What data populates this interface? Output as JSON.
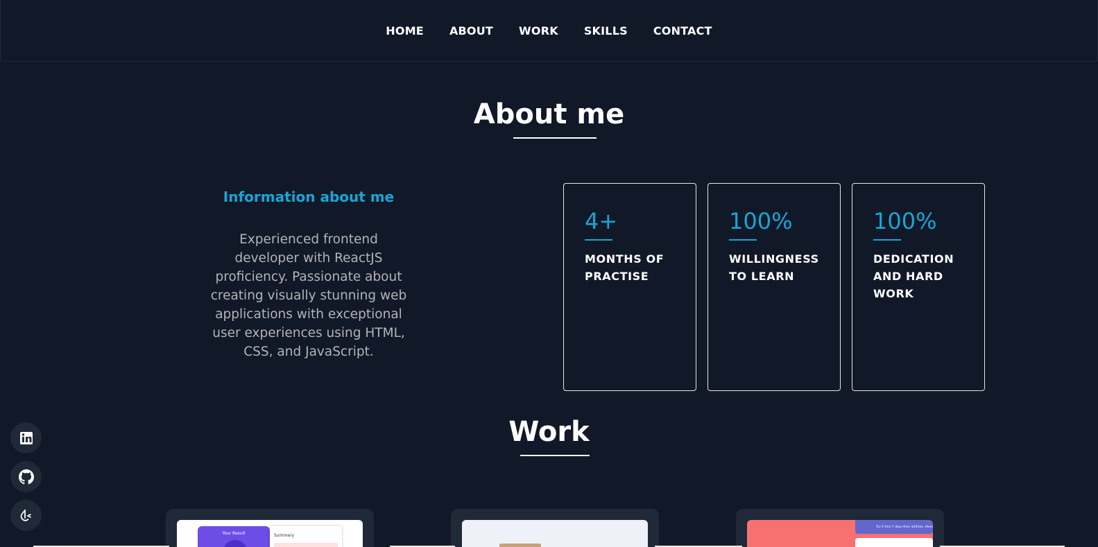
{
  "nav": {
    "items": [
      {
        "label": "HOME"
      },
      {
        "label": "ABOUT"
      },
      {
        "label": "WORK"
      },
      {
        "label": "SKILLS"
      },
      {
        "label": "CONTACT"
      }
    ]
  },
  "about": {
    "title": "About me",
    "info_heading": "Information about me",
    "info_text": "Experienced frontend developer with ReactJS proficiency. Passionate about creating visually stunning web applications with exceptional user experiences using HTML, CSS, and JavaScript.",
    "stats": [
      {
        "value": "4+",
        "label": "MONTHS OF PRACTISE"
      },
      {
        "value": "100%",
        "label": "WILLINGNESS TO LEARN"
      },
      {
        "value": "100%",
        "label": "DEDICATION AND HARD WORK"
      }
    ]
  },
  "work": {
    "title": "Work",
    "cards": [
      {
        "thumb_title": "Your Result",
        "thumb_subtitle": "Summary"
      },
      {
        "thumb_title": "",
        "thumb_subtitle": ""
      },
      {
        "thumb_title": "Try it free 7 days then $20/mo. thereafter",
        "thumb_subtitle": ""
      }
    ]
  },
  "social": {
    "items": [
      {
        "icon": "linkedin-icon"
      },
      {
        "icon": "github-icon"
      },
      {
        "icon": "leetcode-icon"
      }
    ]
  },
  "colors": {
    "background": "#111827",
    "accent": "#17a6d6",
    "card_bg": "#1f2937"
  }
}
